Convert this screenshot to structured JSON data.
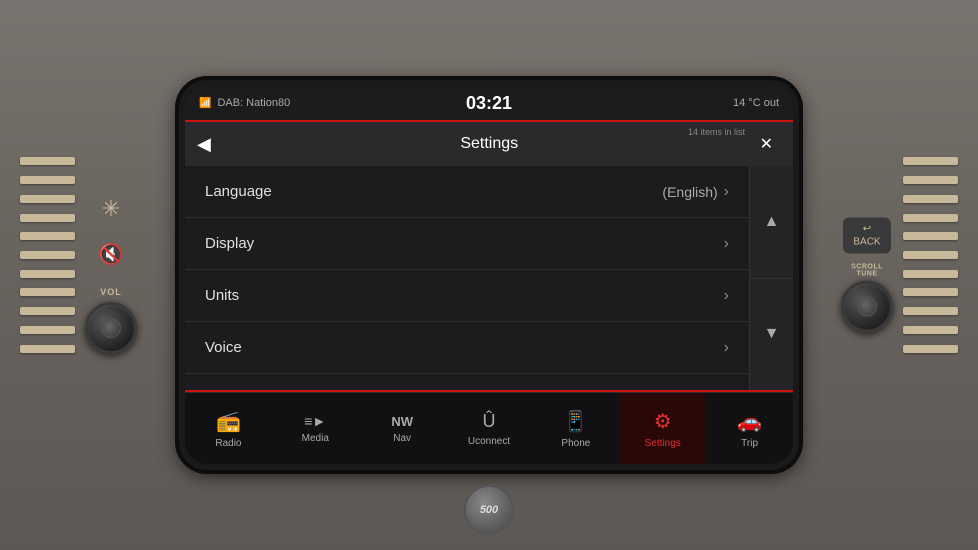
{
  "status": {
    "radio_type": "DAB: Nation80",
    "time": "03:21",
    "temperature": "14 °C out"
  },
  "header": {
    "title": "Settings",
    "items_count": "14 items in list"
  },
  "menu": {
    "items": [
      {
        "label": "Language",
        "value": "(English)",
        "has_chevron": true
      },
      {
        "label": "Display",
        "value": "",
        "has_chevron": true
      },
      {
        "label": "Units",
        "value": "",
        "has_chevron": true
      },
      {
        "label": "Voice",
        "value": "",
        "has_chevron": true
      }
    ]
  },
  "nav": {
    "items": [
      {
        "label": "Radio",
        "icon": "📻",
        "active": false
      },
      {
        "label": "Media",
        "icon": "≡►",
        "active": false
      },
      {
        "label": "Nav",
        "icon": "NW",
        "active": false
      },
      {
        "label": "Uconnect",
        "icon": "Û",
        "active": false
      },
      {
        "label": "Phone",
        "icon": "📱",
        "active": false
      },
      {
        "label": "Settings",
        "icon": "⚙",
        "active": true
      },
      {
        "label": "Trip",
        "icon": "🚗",
        "active": false
      }
    ]
  },
  "controls": {
    "vol_label": "VOL",
    "scroll_tune_label": "SCROLL TUNE",
    "back_label": "BACK"
  }
}
